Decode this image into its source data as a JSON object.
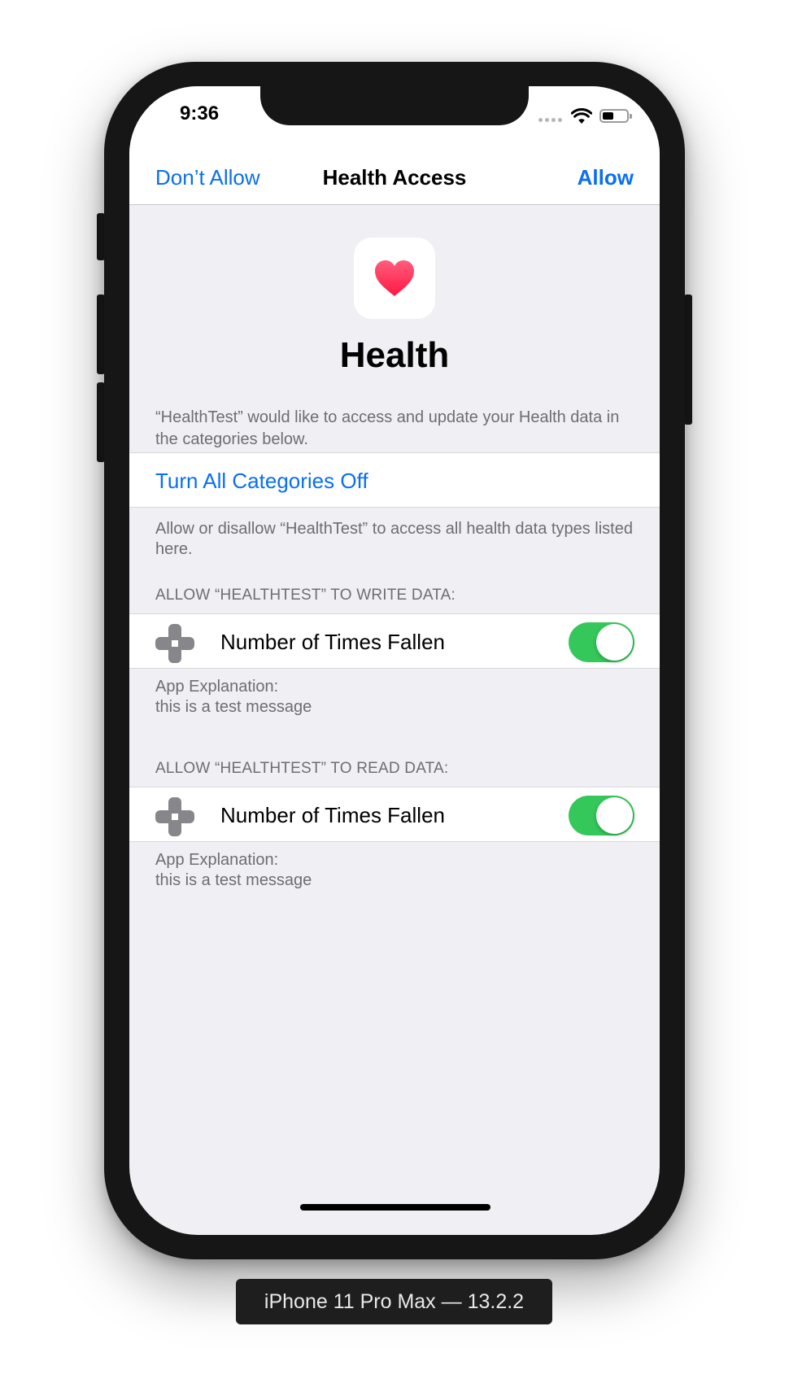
{
  "status_bar": {
    "time": "9:36"
  },
  "nav": {
    "left_button": "Don’t Allow",
    "title": "Health Access",
    "right_button": "Allow"
  },
  "app": {
    "icon": "heart-icon",
    "name": "Health",
    "intro": "“HealthTest” would like to access and update your Health data in the categories below."
  },
  "turn_off": {
    "label": "Turn All Categories Off",
    "footer": "Allow or disallow “HealthTest” to access all health data types listed here."
  },
  "sections": [
    {
      "header": "ALLOW “HEALTHTEST” TO WRITE DATA:",
      "item_label": "Number of Times Fallen",
      "item_icon": "health-cross-icon",
      "toggle_on": true,
      "explanation_title": "App Explanation:",
      "explanation_text": "this is a test message"
    },
    {
      "header": "ALLOW “HEALTHTEST” TO READ DATA:",
      "item_label": "Number of Times Fallen",
      "item_icon": "health-cross-icon",
      "toggle_on": true,
      "explanation_title": "App Explanation:",
      "explanation_text": "this is a test message"
    }
  ],
  "colors": {
    "accent": "#0a6ff0",
    "toggle_on": "#34c759",
    "heart": "#ff2d55",
    "background": "#efeff4"
  },
  "device_label": "iPhone 11 Pro Max — 13.2.2"
}
